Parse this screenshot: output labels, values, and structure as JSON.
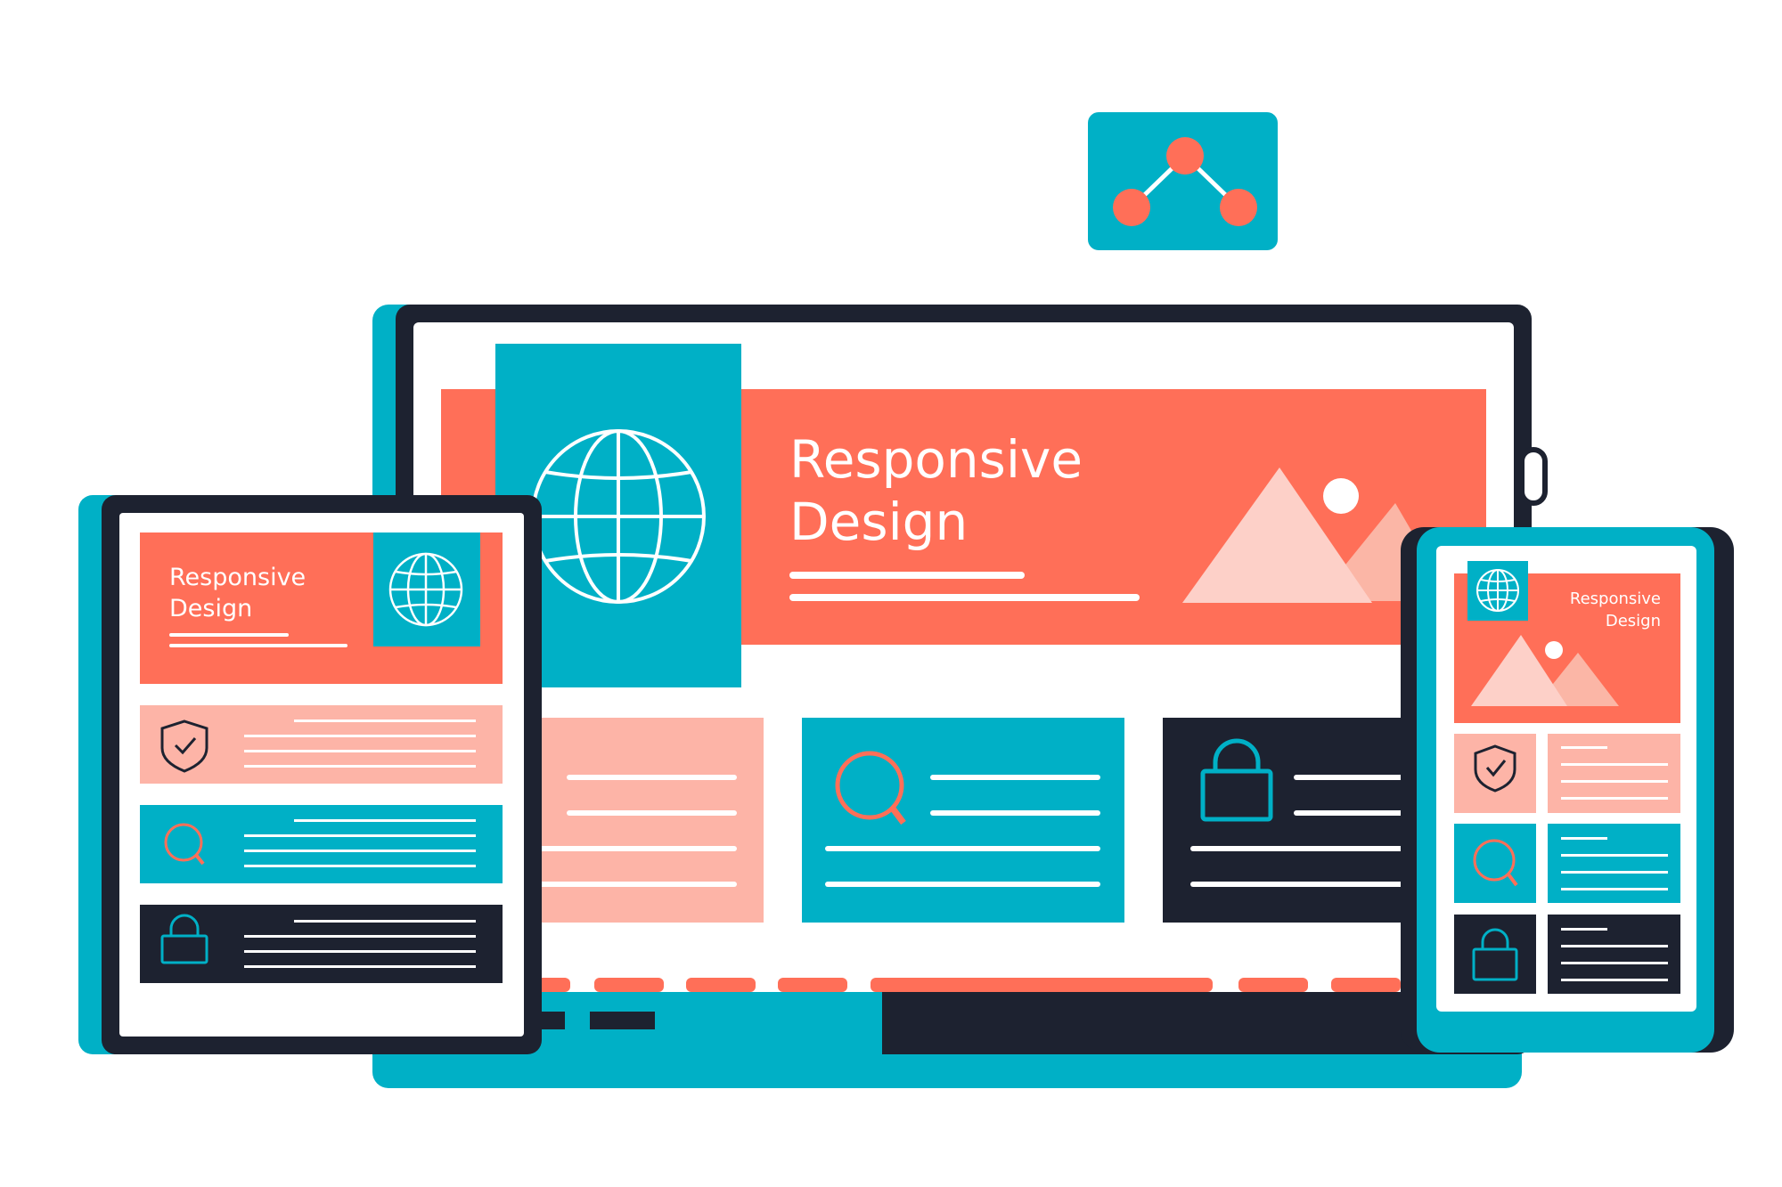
{
  "colors": {
    "teal": "#00b0c6",
    "coral": "#ff6f58",
    "salmon": "#fdb4a7",
    "navy": "#1d2230",
    "white": "#ffffff",
    "mountain_light": "#fdd0c8",
    "mountain_shade": "#fbb6a6"
  },
  "share_badge": {
    "icon": "share-icon"
  },
  "monitor": {
    "hero": {
      "title_line1": "Responsive",
      "title_line2": "Design",
      "icons": [
        "globe-icon",
        "image-mountain-icon"
      ]
    },
    "cards": [
      {
        "icon": "shield-check-icon",
        "style": "salmon"
      },
      {
        "icon": "search-icon",
        "style": "teal"
      },
      {
        "icon": "lock-icon",
        "style": "navy"
      }
    ]
  },
  "tablet": {
    "hero": {
      "title_line1": "Responsive",
      "title_line2": "Design",
      "icon": "globe-icon"
    },
    "rows": [
      {
        "icon": "shield-check-icon",
        "style": "salmon"
      },
      {
        "icon": "search-icon",
        "style": "teal"
      },
      {
        "icon": "lock-icon",
        "style": "navy"
      }
    ]
  },
  "phone": {
    "hero": {
      "title_line1": "Responsive",
      "title_line2": "Design",
      "icons": [
        "globe-icon",
        "image-mountain-icon"
      ]
    },
    "rows": [
      {
        "icon": "shield-check-icon",
        "style": "salmon"
      },
      {
        "icon": "search-icon",
        "style": "teal"
      },
      {
        "icon": "lock-icon",
        "style": "navy"
      }
    ]
  }
}
